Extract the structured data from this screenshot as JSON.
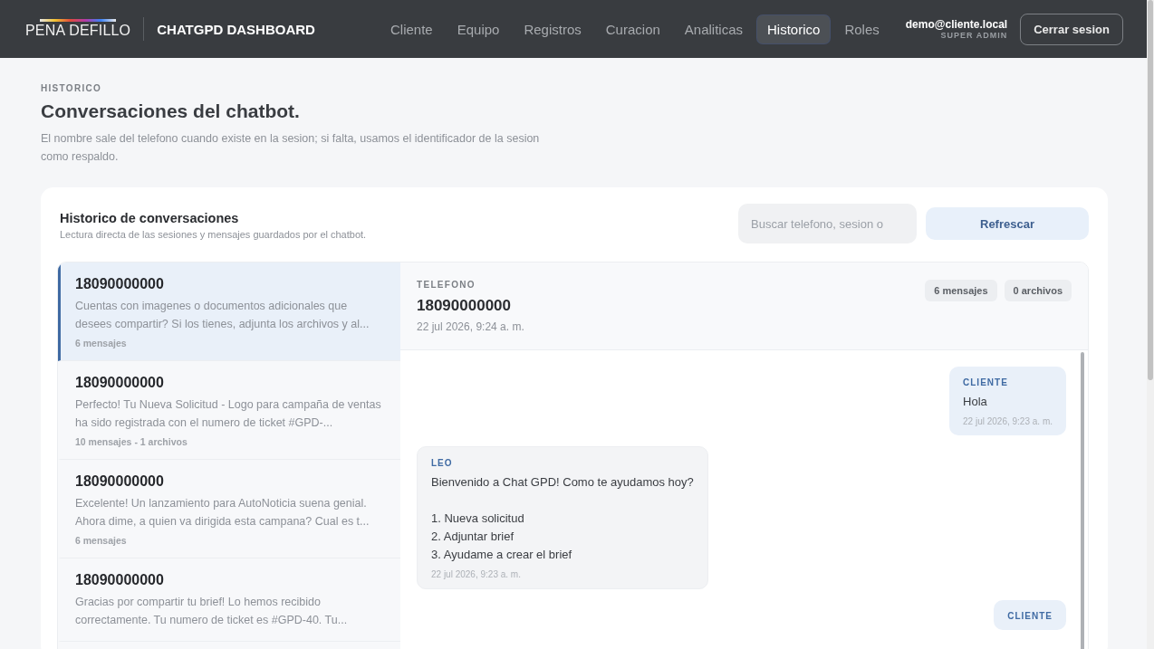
{
  "header": {
    "logo": "PENA DEFILLO",
    "app_title": "CHATGPD DASHBOARD",
    "nav": [
      {
        "label": "Cliente",
        "selected": false
      },
      {
        "label": "Equipo",
        "selected": false
      },
      {
        "label": "Registros",
        "selected": false
      },
      {
        "label": "Curacion",
        "selected": false
      },
      {
        "label": "Analiticas",
        "selected": false
      },
      {
        "label": "Historico",
        "selected": true
      },
      {
        "label": "Roles",
        "selected": false
      }
    ],
    "user_email": "demo@cliente.local",
    "user_role": "SUPER ADMIN",
    "logout": "Cerrar sesion"
  },
  "page": {
    "eyebrow": "HISTORICO",
    "title": "Conversaciones del chatbot.",
    "description": "El nombre sale del telefono cuando existe en la sesion; si falta, usamos el identificador de la sesion como respaldo."
  },
  "card": {
    "title": "Historico de conversaciones",
    "subtitle": "Lectura directa de las sesiones y mensajes guardados por el chatbot.",
    "search": {
      "placeholder": "Buscar telefono, sesion o"
    },
    "refresh": "Refrescar"
  },
  "conversations": [
    {
      "phone": "18090000000",
      "preview": "Cuentas con imagenes o documentos adicionales que desees compartir? Si los tienes, adjunta los archivos y al...",
      "meta": "6 mensajes",
      "selected": true
    },
    {
      "phone": "18090000000",
      "preview": "Perfecto! Tu Nueva Solicitud - Logo para campaña de ventas ha sido registrada con el numero de ticket #GPD-...",
      "meta": "10 mensajes - 1 archivos",
      "selected": false
    },
    {
      "phone": "18090000000",
      "preview": "Excelente! Un lanzamiento para AutoNoticia suena genial. Ahora dime, a quien va dirigida esta campana? Cual es t...",
      "meta": "6 mensajes",
      "selected": false
    },
    {
      "phone": "18090000000",
      "preview": "Gracias por compartir tu brief! Lo hemos recibido correctamente. Tu numero de ticket es #GPD-40. Tu...",
      "selected": false
    }
  ],
  "detail": {
    "label": "TELEFONO",
    "phone": "18090000000",
    "date": "22 jul 2026, 9:24 a. m.",
    "badges": [
      "6 mensajes",
      "0 archivos"
    ],
    "messages": [
      {
        "kind": "client",
        "sender": "CLIENTE",
        "text": "Hola",
        "time": "22 jul 2026, 9:23 a. m."
      },
      {
        "kind": "bot",
        "sender": "LEO",
        "text": "Bienvenido a Chat GPD! Como te ayudamos hoy?\n\n1. Nueva solicitud\n2. Adjuntar brief\n3. Ayudame a crear el brief",
        "time": "22 jul 2026, 9:23 a. m."
      },
      {
        "kind": "client",
        "sender": "CLIENTE"
      }
    ]
  }
}
